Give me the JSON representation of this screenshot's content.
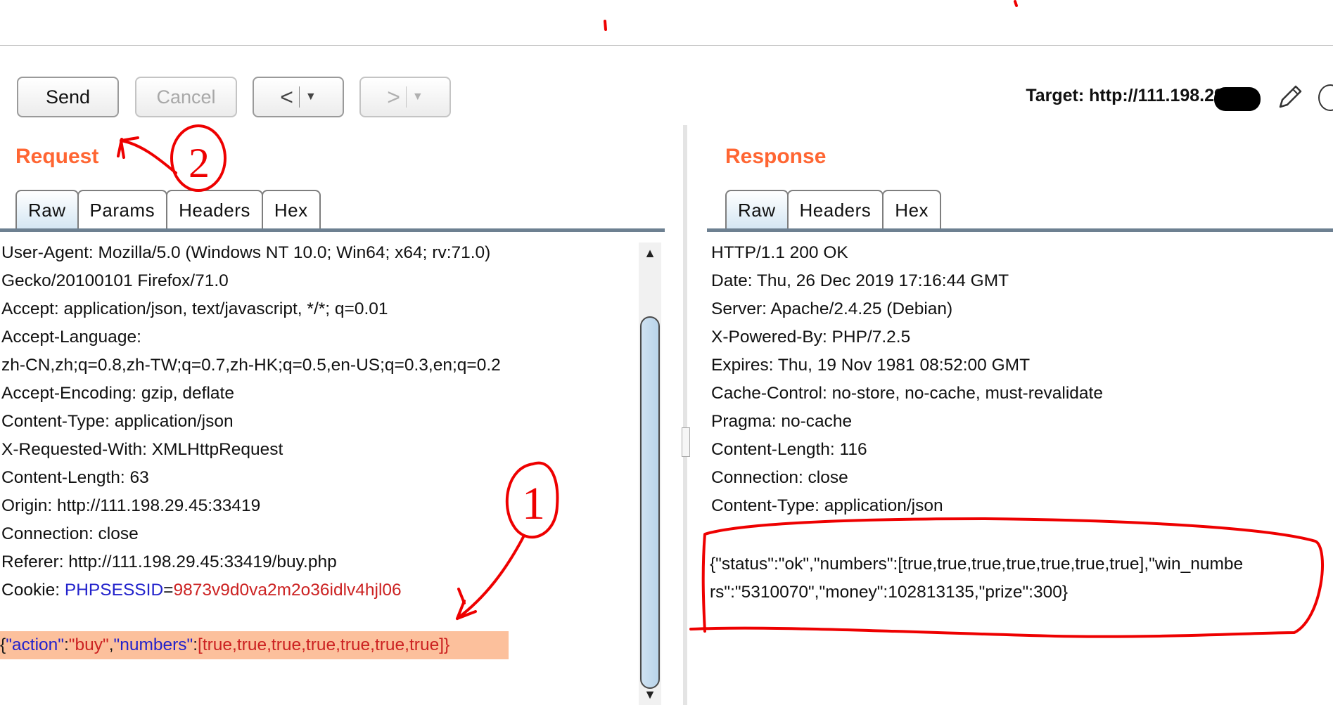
{
  "toolbar": {
    "send_label": "Send",
    "cancel_label": "Cancel",
    "back_glyph": "<",
    "forward_glyph": ">",
    "dropdown_glyph": "▼",
    "target_label": "Target: http://111.198.29.45:"
  },
  "request": {
    "title": "Request",
    "tabs": [
      "Raw",
      "Params",
      "Headers",
      "Hex"
    ],
    "lines": [
      "User-Agent: Mozilla/5.0 (Windows NT 10.0; Win64; x64; rv:71.0)",
      "Gecko/20100101 Firefox/71.0",
      "Accept: application/json, text/javascript, */*; q=0.01",
      "Accept-Language:",
      "zh-CN,zh;q=0.8,zh-TW;q=0.7,zh-HK;q=0.5,en-US;q=0.3,en;q=0.2",
      "Accept-Encoding: gzip, deflate",
      "Content-Type: application/json",
      "X-Requested-With: XMLHttpRequest",
      "Content-Length: 63",
      "Origin: http://111.198.29.45:33419",
      "Connection: close",
      "Referer: http://111.198.29.45:33419/buy.php"
    ],
    "cookie": {
      "label": "Cookie: ",
      "name": "PHPSESSID",
      "equals": "=",
      "value": "9873v9d0va2m2o36idlv4hjl06"
    },
    "body": {
      "open": "{",
      "key1": "\"action\"",
      "colon1": ":",
      "val1": "\"buy\"",
      "comma1": ",",
      "key2": "\"numbers\"",
      "colon2": ":",
      "val2": "[true,true,true,true,true,true,true]}"
    }
  },
  "response": {
    "title": "Response",
    "tabs": [
      "Raw",
      "Headers",
      "Hex"
    ],
    "lines": [
      "HTTP/1.1 200 OK",
      "Date: Thu, 26 Dec 2019 17:16:44 GMT",
      "Server: Apache/2.4.25 (Debian)",
      "X-Powered-By: PHP/7.2.5",
      "Expires: Thu, 19 Nov 1981 08:52:00 GMT",
      "Cache-Control: no-store, no-cache, must-revalidate",
      "Pragma: no-cache",
      "Content-Length: 116",
      "Connection: close",
      "Content-Type: application/json"
    ],
    "body_lines": [
      "{\"status\":\"ok\",\"numbers\":[true,true,true,true,true,true,true],\"win_numbe",
      "rs\":\"5310070\",\"money\":102813135,\"prize\":300}"
    ]
  },
  "scrollbar": {
    "up_glyph": "▲",
    "down_glyph": "▼"
  },
  "annotations": {
    "mark1": "1",
    "mark2": "2"
  },
  "colors": {
    "section_title": "#ff6633",
    "annotation_red": "#ee0000",
    "highlight": "#fcc09c",
    "json_key": "#2222cc",
    "json_value": "#cc2222"
  }
}
